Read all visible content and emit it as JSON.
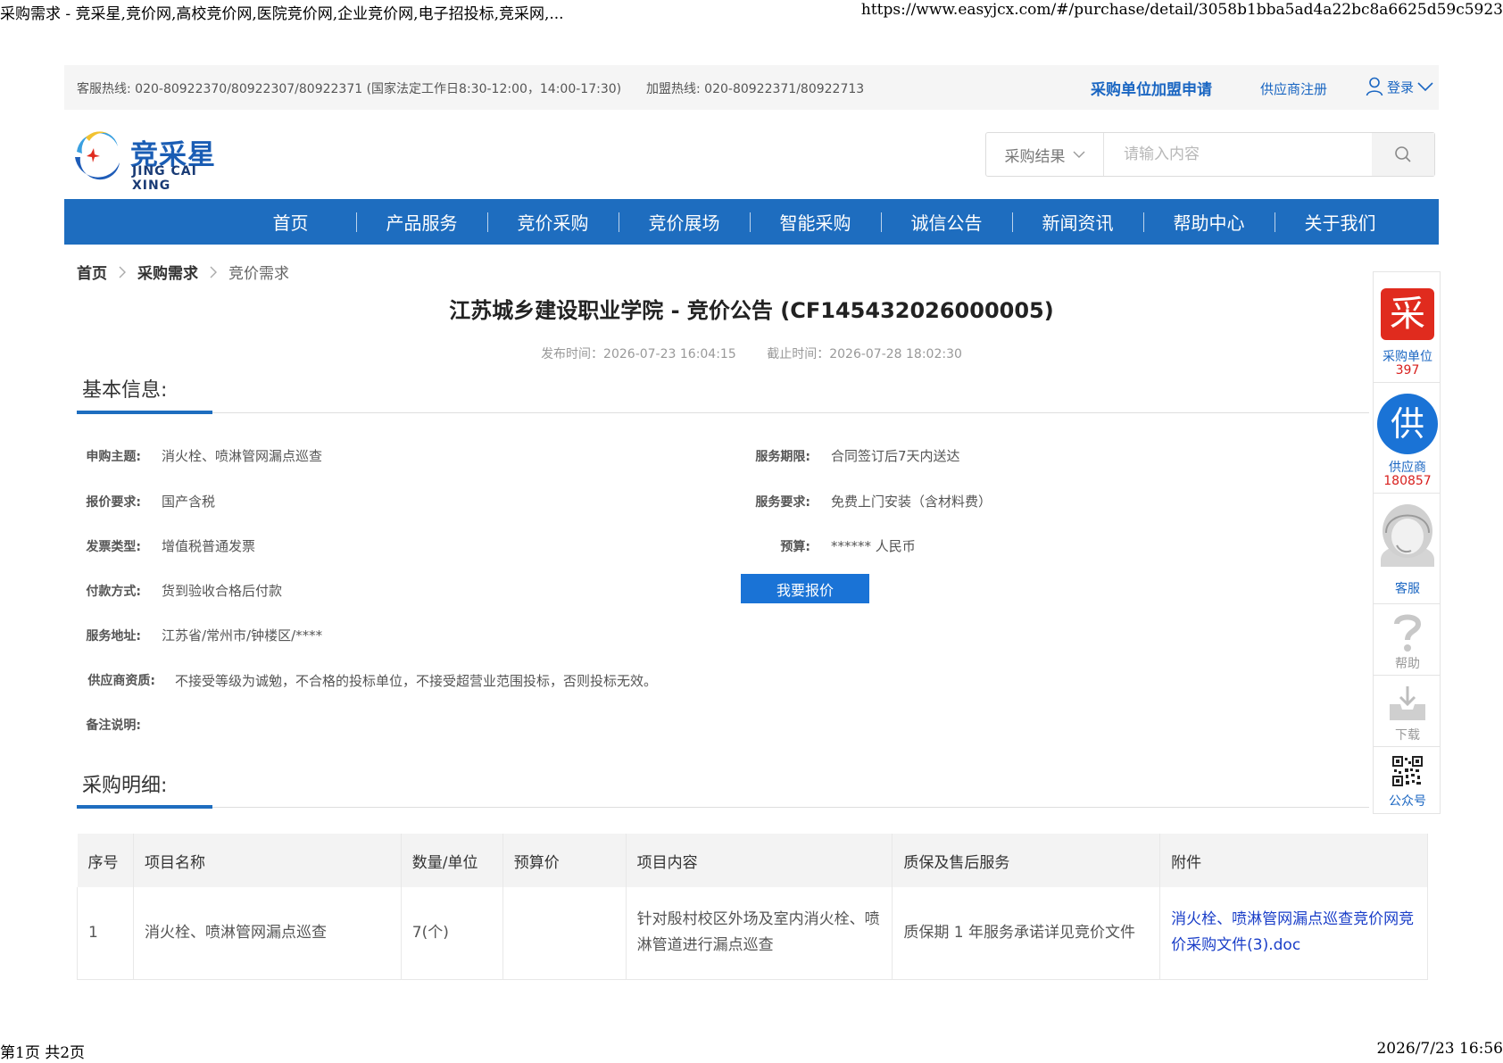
{
  "print_header": {
    "title": "采购需求 - 竞采星,竞价网,高校竞价网,医院竞价网,企业竞价网,电子招投标,竞采网,...",
    "url": "https://www.easyjcx.com/#/purchase/detail/3058b1bba5ad4a22bc8a6625d59c5923"
  },
  "print_footer": {
    "page": "第1页 共2页",
    "datetime": "2026/7/23 16:56"
  },
  "topbar": {
    "hotline": "客服热线: 020-80922370/80922307/80922371 (国家法定工作日8:30-12:00，14:00-17:30)",
    "join_hotline": "加盟热线: 020-80922371/80922713",
    "join_apply": "采购单位加盟申请",
    "supplier_register": "供应商注册",
    "login": "登录"
  },
  "logo": {
    "cn": "竞采星",
    "en": "JING CAI XING"
  },
  "search": {
    "category": "采购结果",
    "placeholder": "请输入内容"
  },
  "nav": [
    "首页",
    "产品服务",
    "竞价采购",
    "竞价展场",
    "智能采购",
    "诚信公告",
    "新闻资讯",
    "帮助中心",
    "关于我们"
  ],
  "breadcrumb": {
    "home": "首页",
    "parent": "采购需求",
    "current": "竞价需求"
  },
  "notice": {
    "title": "江苏城乡建设职业学院 - 竞价公告 (CF145432026000005)",
    "publish_time": "发布时间：2026-07-23 16:04:15",
    "deadline": "截止时间：2026-07-28 18:02:30"
  },
  "basic_info": {
    "heading": "基本信息:",
    "subject_label": "申购主题:",
    "subject": "消火栓、喷淋管网漏点巡查",
    "service_period_label": "服务期限:",
    "service_period": "合同签订后7天内送达",
    "quote_req_label": "报价要求:",
    "quote_req": "国产含税",
    "service_req_label": "服务要求:",
    "service_req": "免费上门安装（含材料费）",
    "invoice_label": "发票类型:",
    "invoice": "增值税普通发票",
    "budget_label": "预算:",
    "budget": "****** 人民币",
    "payment_label": "付款方式:",
    "payment": "货到验收合格后付款",
    "quote_button": "我要报价",
    "address_label": "服务地址:",
    "address": "江苏省/常州市/钟楼区/****",
    "qualification_label": "供应商资质:",
    "qualification": "不接受等级为诚勉，不合格的投标单位，不接受超营业范围投标，否则投标无效。",
    "remark_label": "备注说明:"
  },
  "purchase_detail": {
    "heading": "采购明细:",
    "columns": [
      "序号",
      "项目名称",
      "数量/单位",
      "预算价",
      "项目内容",
      "质保及售后服务",
      "附件"
    ],
    "rows": [
      {
        "no": "1",
        "name": "消火栓、喷淋管网漏点巡查",
        "qty": "7(个)",
        "budget": "",
        "content": "针对殷村校区外场及室内消火栓、喷淋管道进行漏点巡查",
        "warranty": "质保期 1 年服务承诺详见竞价文件",
        "attachment": "消火栓、喷淋管网漏点巡查竞价网竞价采购文件(3).doc"
      }
    ]
  },
  "sidebar": {
    "buyer_icon": "采",
    "buyer_label": "采购单位",
    "buyer_count": "397",
    "supplier_icon": "供",
    "supplier_label": "供应商",
    "supplier_count": "180857",
    "service_label": "客服",
    "help_label": "帮助",
    "download_label": "下载",
    "wechat_label": "公众号"
  },
  "colors": {
    "brand_blue": "#1e6dbf",
    "link_blue": "#1a66c2",
    "buyer_red": "#e02b1e",
    "count_red": "#d8201e"
  },
  "icons": [
    "user-icon",
    "chevron-down-icon",
    "search-icon",
    "chevron-right-icon",
    "headset-agent-icon",
    "question-icon",
    "download-tray-icon",
    "qr-code-icon"
  ]
}
